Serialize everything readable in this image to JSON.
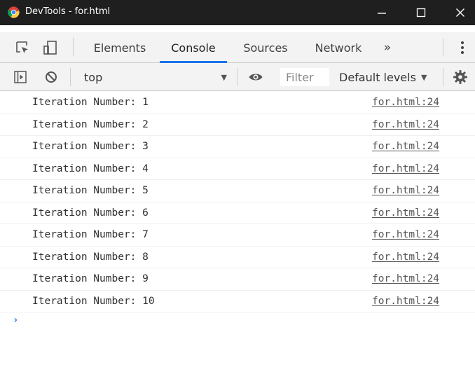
{
  "window": {
    "title": "DevTools - for.html",
    "controls": {
      "minimize": "—",
      "maximize": "☐",
      "close": "✕"
    }
  },
  "tabs": [
    {
      "label": "Elements",
      "active": false
    },
    {
      "label": "Console",
      "active": true
    },
    {
      "label": "Sources",
      "active": false
    },
    {
      "label": "Network",
      "active": false
    }
  ],
  "tabs_overflow": "»",
  "console_toolbar": {
    "context": "top",
    "filter_placeholder": "Filter",
    "levels": "Default levels"
  },
  "messages": [
    {
      "text": "Iteration Number: 1",
      "source": "for.html:24"
    },
    {
      "text": "Iteration Number: 2",
      "source": "for.html:24"
    },
    {
      "text": "Iteration Number: 3",
      "source": "for.html:24"
    },
    {
      "text": "Iteration Number: 4",
      "source": "for.html:24"
    },
    {
      "text": "Iteration Number: 5",
      "source": "for.html:24"
    },
    {
      "text": "Iteration Number: 6",
      "source": "for.html:24"
    },
    {
      "text": "Iteration Number: 7",
      "source": "for.html:24"
    },
    {
      "text": "Iteration Number: 8",
      "source": "for.html:24"
    },
    {
      "text": "Iteration Number: 9",
      "source": "for.html:24"
    },
    {
      "text": "Iteration Number: 10",
      "source": "for.html:24"
    }
  ],
  "prompt_symbol": "›",
  "icons": [
    "chrome-logo-icon",
    "inspect-icon",
    "device-toolbar-icon",
    "more-menu-icon",
    "sidebar-toggle-icon",
    "clear-console-icon",
    "eye-icon",
    "gear-icon"
  ],
  "colors": {
    "titlebar": "#1f1f1f",
    "active_tab_underline": "#1a73e8",
    "toolbar": "#f3f3f3",
    "prompt": "#1a73e8"
  }
}
